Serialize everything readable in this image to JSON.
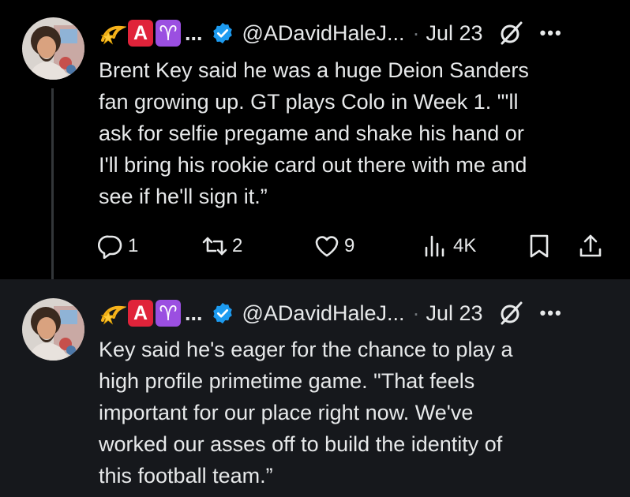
{
  "tweets": [
    {
      "emojis": [
        "dizzy-emoji",
        "a-button-emoji",
        "aries-emoji"
      ],
      "ellipsis": "...",
      "handle": "@ADavidHaleJ...",
      "separator": "·",
      "date": "Jul 23",
      "more": "•••",
      "text": "Brent Key said he was a huge Deion Sanders\nfan growing up. GT plays Colo in Week 1. \"'ll\nask for selfie pregame and shake his hand or\nI'll bring his rookie card out there with me and\nsee if he'll sign it.”",
      "actions": {
        "replies": "1",
        "reposts": "2",
        "likes": "9",
        "views": "4K"
      }
    },
    {
      "emojis": [
        "dizzy-emoji",
        "a-button-emoji",
        "aries-emoji"
      ],
      "ellipsis": "...",
      "handle": "@ADavidHaleJ...",
      "separator": "·",
      "date": "Jul 23",
      "more": "•••",
      "text": "Key said he's eager for the chance to play a\nhigh profile primetime game. \"That feels\nimportant for our place right now. We've\nworked our asses off to build the identity of\nthis football team.”"
    }
  ],
  "colors": {
    "background": "#000000",
    "highlight_background": "#16181c",
    "text": "#e7e9ea",
    "muted": "#71767b",
    "verified": "#1d9bf0",
    "thread_line": "#333639"
  },
  "emoji_labels": {
    "a": "A",
    "aries": "♈"
  }
}
